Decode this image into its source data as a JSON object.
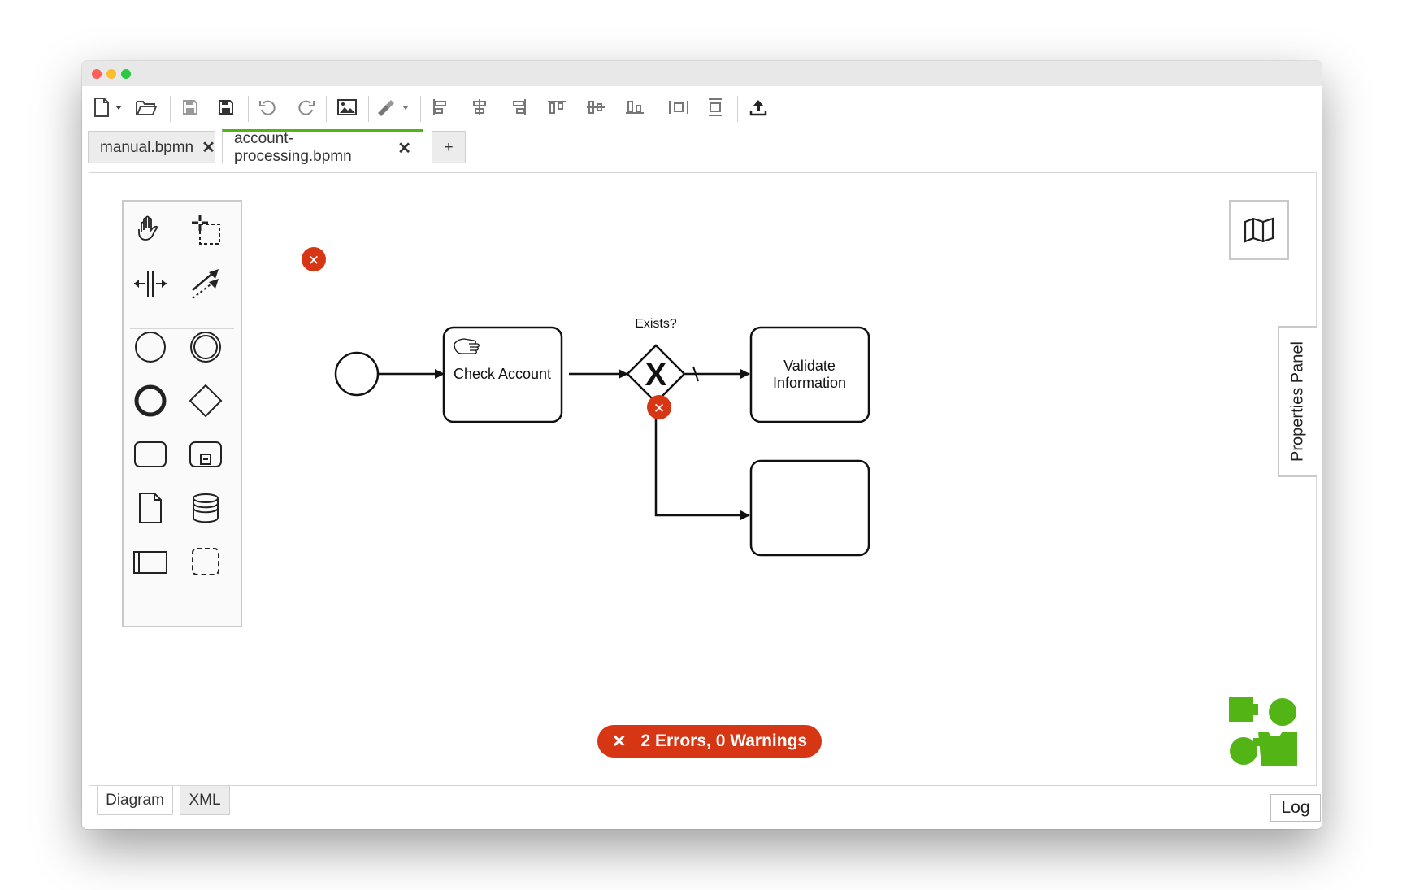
{
  "window": {
    "traffic_lights": [
      "#ff5f57",
      "#febc2e",
      "#28c840"
    ]
  },
  "toolbar": {
    "icons": [
      "new-file-icon",
      "open-folder-icon",
      "save-icon",
      "save-as-icon",
      "undo-icon",
      "redo-icon",
      "export-image-icon",
      "color-brush-icon",
      "align-left-icon",
      "align-center-icon",
      "align-right-icon",
      "align-top-icon",
      "align-middle-icon",
      "align-bottom-icon",
      "distribute-horizontal-icon",
      "distribute-vertical-icon",
      "deploy-icon"
    ]
  },
  "tabs": [
    {
      "label": "manual.bpmn",
      "close": "✕",
      "active": false
    },
    {
      "label": "account-processing.bpmn",
      "close": "✕",
      "active": true
    }
  ],
  "add_tab_label": "+",
  "palette": {
    "tools": [
      "hand-tool-icon",
      "lasso-tool-icon",
      "space-tool-icon",
      "connect-tool-icon"
    ],
    "elements": [
      "start-event-icon",
      "intermediate-event-icon",
      "end-event-icon",
      "gateway-icon",
      "task-icon",
      "subprocess-icon",
      "data-object-icon",
      "data-store-icon",
      "pool-icon",
      "group-icon"
    ]
  },
  "properties_panel_label": "Properties Panel",
  "diagram": {
    "task_check_account": "Check Account",
    "gateway_label": "Exists?",
    "gateway_marker": "X",
    "task_validate_line1": "Validate",
    "task_validate_line2": "Information",
    "error_marker": "✕"
  },
  "status": {
    "icon": "✕",
    "text": "2 Errors, 0 Warnings",
    "color": "#d63614"
  },
  "accent_color": "#52b415",
  "bottom_tabs": [
    {
      "label": "Diagram",
      "active": true
    },
    {
      "label": "XML",
      "active": false
    }
  ],
  "log_label": "Log"
}
